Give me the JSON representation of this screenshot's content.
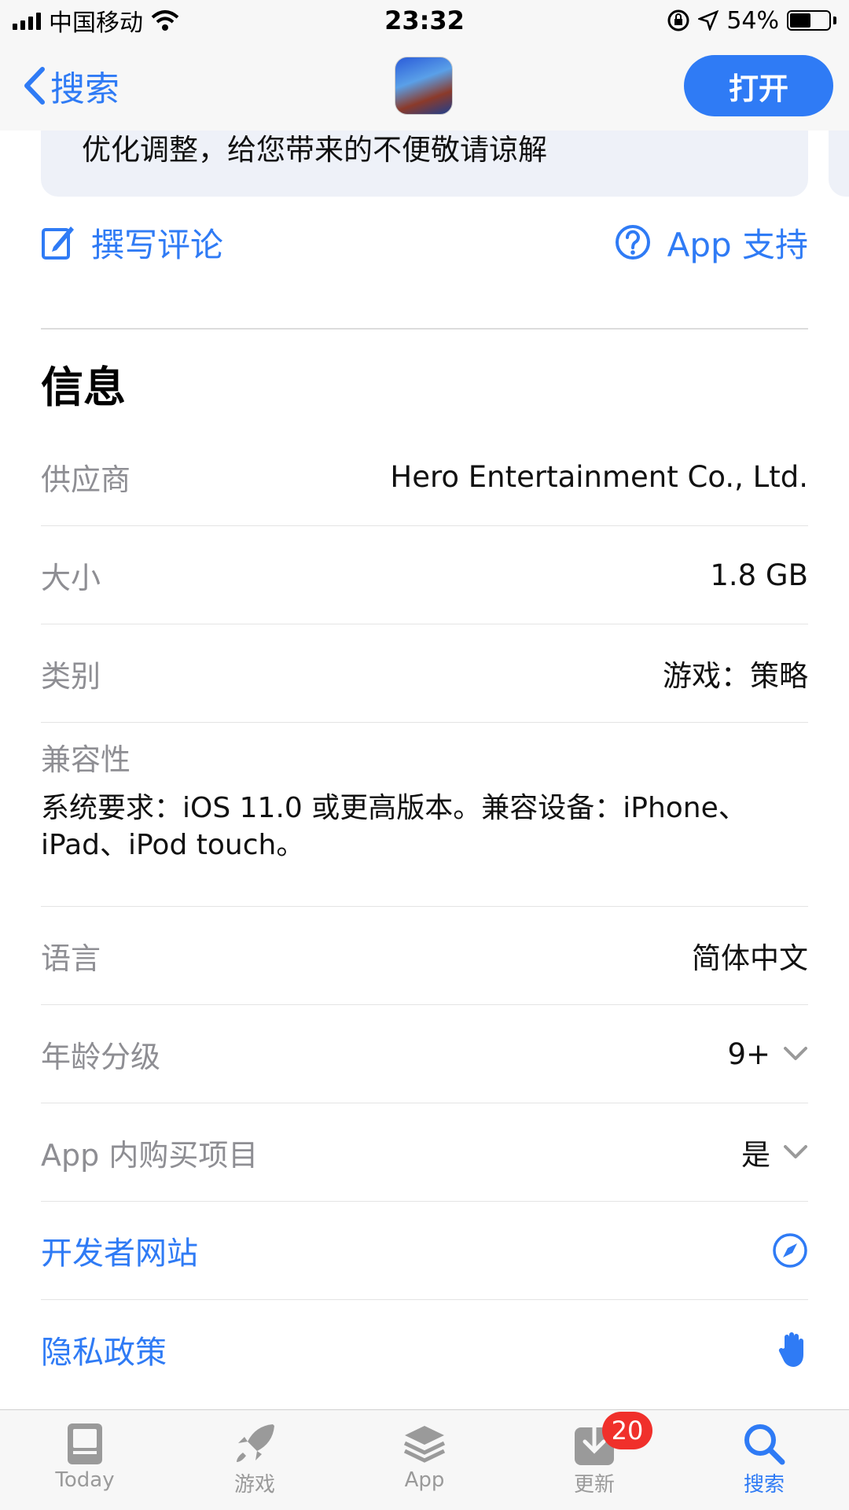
{
  "status_bar": {
    "carrier": "中国移动",
    "time": "23:32",
    "battery": "54%",
    "battery_level": 0.54
  },
  "nav": {
    "back_label": "搜索",
    "open_label": "打开"
  },
  "notes": {
    "text": "优化调整，给您带来的不便敬请谅解"
  },
  "actions": {
    "write_review": "撰写评论",
    "app_support": "App 支持"
  },
  "info": {
    "title": "信息",
    "provider_label": "供应商",
    "provider_value": "Hero Entertainment Co., Ltd.",
    "size_label": "大小",
    "size_value": "1.8 GB",
    "category_label": "类别",
    "category_value": "游戏：策略",
    "compat_label": "兼容性",
    "compat_value": "系统要求：iOS 11.0 或更高版本。兼容设备：iPhone、iPad、iPod touch。",
    "language_label": "语言",
    "language_value": "简体中文",
    "age_label": "年龄分级",
    "age_value": "9+",
    "iap_label": "App 内购买项目",
    "iap_value": "是",
    "developer_site": "开发者网站",
    "privacy_policy": "隐私政策"
  },
  "tabs": [
    {
      "label": "Today",
      "icon": "today-icon"
    },
    {
      "label": "游戏",
      "icon": "rocket-icon"
    },
    {
      "label": "App",
      "icon": "app-stack-icon"
    },
    {
      "label": "更新",
      "icon": "download-icon",
      "badge": "20"
    },
    {
      "label": "搜索",
      "icon": "search-icon",
      "active": true
    }
  ],
  "colors": {
    "accent": "#2f7bf5",
    "badge": "#f0302b",
    "secondary_text": "#8e8e93"
  }
}
